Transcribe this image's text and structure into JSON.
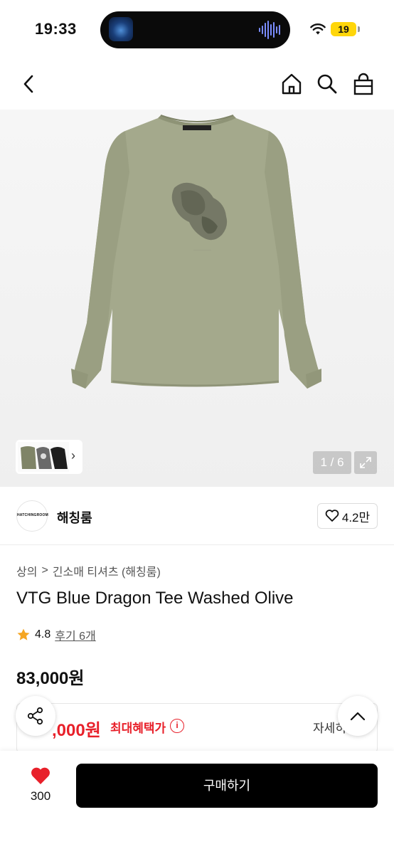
{
  "status": {
    "time": "19:33",
    "battery": "19"
  },
  "header": {
    "icons": [
      "back-arrow-icon",
      "home-icon",
      "search-icon",
      "shopping-bag-icon"
    ]
  },
  "gallery": {
    "counter": "1 / 6",
    "thumb_more": "›"
  },
  "brand": {
    "logo_text": "HATCHINGROOM",
    "name": "해칭룸",
    "likes": "4.2만"
  },
  "product": {
    "breadcrumb": [
      "상의",
      "긴소매 티셔츠 (해칭룸)"
    ],
    "breadcrumb_sep": ">",
    "title": "VTG Blue Dragon Tee Washed Olive",
    "rating": "4.8",
    "reviews": "후기 6개",
    "price": "83,000원"
  },
  "benefit": {
    "price": ",000원",
    "label": "최대혜택가",
    "info": "i",
    "detail": "자세히"
  },
  "bottom": {
    "wish_count": "300",
    "buy_label": "구매하기"
  },
  "colors": {
    "accent_red": "#e8202a",
    "buy_button": "#000000",
    "star": "#f5a623",
    "shirt": "#a4a98c"
  }
}
